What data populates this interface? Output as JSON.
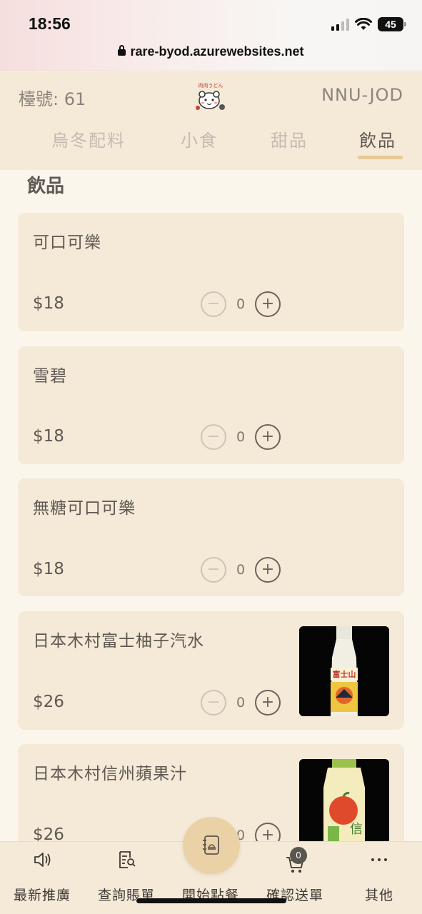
{
  "status_bar": {
    "time": "18:56",
    "battery": "45",
    "url": "rare-byod.azurewebsites.net"
  },
  "header": {
    "table_label": "檯號: 61",
    "order_code": "NNU-JOD",
    "logo_text": "肉肉うどん",
    "tabs": [
      {
        "label": "烏冬配料",
        "active": false
      },
      {
        "label": "小食",
        "active": false
      },
      {
        "label": "甜品",
        "active": false
      },
      {
        "label": "飲品",
        "active": true
      }
    ]
  },
  "section_title": "飲品",
  "items": [
    {
      "name": "可口可樂",
      "price": "$18",
      "qty": "0",
      "minus": "−",
      "plus": "+",
      "has_image": false
    },
    {
      "name": "雪碧",
      "price": "$18",
      "qty": "0",
      "minus": "−",
      "plus": "+",
      "has_image": false
    },
    {
      "name": "無糖可口可樂",
      "price": "$18",
      "qty": "0",
      "minus": "−",
      "plus": "+",
      "has_image": false
    },
    {
      "name": "日本木村富士柚子汽水",
      "price": "$26",
      "qty": "0",
      "minus": "−",
      "plus": "+",
      "has_image": true,
      "image_label": "富士山",
      "image_color": "#f3d36b"
    },
    {
      "name": "日本木村信州蘋果汁",
      "price": "$26",
      "qty": "0",
      "minus": "−",
      "plus": "+",
      "has_image": true,
      "image_label": "信",
      "image_color": "#e04a2c"
    }
  ],
  "bottom_nav": [
    {
      "label": "最新推廣",
      "icon": "speaker-icon"
    },
    {
      "label": "查詢賬單",
      "icon": "receipt-search-icon"
    },
    {
      "label": "開始點餐",
      "icon": "menu-book-icon"
    },
    {
      "label": "確認送單",
      "icon": "cart-icon",
      "badge": "0"
    },
    {
      "label": "其他",
      "icon": "more-icon"
    }
  ],
  "colors": {
    "accent": "#e7c995",
    "card": "#f5e9d7",
    "background": "#fbf6ec",
    "text": "#5e5953"
  }
}
